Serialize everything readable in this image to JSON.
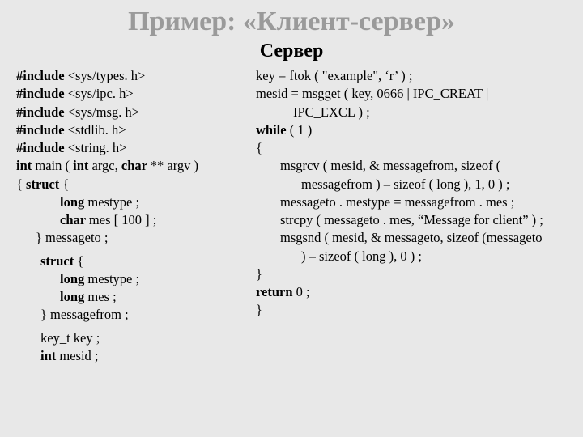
{
  "title": "Пример: «Клиент-сервер»",
  "subtitle": "Сервер",
  "left": {
    "inc1a": "#include ",
    "inc1b": "<sys/types. h>",
    "inc2a": "#include ",
    "inc2b": "<sys/ipc. h>",
    "inc3a": "#include ",
    "inc3b": "<sys/msg. h>",
    "inc4a": "#include ",
    "inc4b": "<stdlib. h>",
    "inc5a": "#include ",
    "inc5b": "<string. h>",
    "main1": "int ",
    "main2": "main ( ",
    "main3": "int ",
    "main4": "argc, ",
    "main5": "char ",
    "main6": "** argv )",
    "l7a": "{   ",
    "l7b": "struct ",
    "l7c": "{",
    "l8a": "long ",
    "l8b": "mestype ;",
    "l9a": "char ",
    "l9b": "mes [ 100 ] ;",
    "l10": "} messageto ;",
    "l11a": "struct ",
    "l11b": "{",
    "l12a": "long ",
    "l12b": "mestype ;",
    "l13a": "long ",
    "l13b": "mes ;",
    "l14": "} messagefrom ;",
    "l15": "key_t key ;",
    "l16a": "int ",
    "l16b": "mesid ;"
  },
  "right": {
    "r1": "key = ftok ( \"example\", ‘r’ ) ;",
    "r2": "mesid = msgget ( key, 0666 | IPC_CREAT |",
    "r3": "IPC_EXCL ) ;",
    "r4a": "while ",
    "r4b": "( 1 )",
    "r5": "{",
    "r6": "msgrcv ( mesid, & messagefrom, sizeof (",
    "r7": "messagefrom ) – sizeof ( long ), 1, 0 ) ;",
    "r8": "messageto . mestype = messagefrom . mes ;",
    "r9": "strcpy ( messageto . mes, “Message for client” ) ;",
    "r10": "msgsnd ( mesid, & messageto, sizeof (messageto",
    "r11": ") – sizeof ( long ),     0 ) ;",
    "r12": "}",
    "r13a": "return ",
    "r13b": "0 ;",
    "r14": "}"
  }
}
